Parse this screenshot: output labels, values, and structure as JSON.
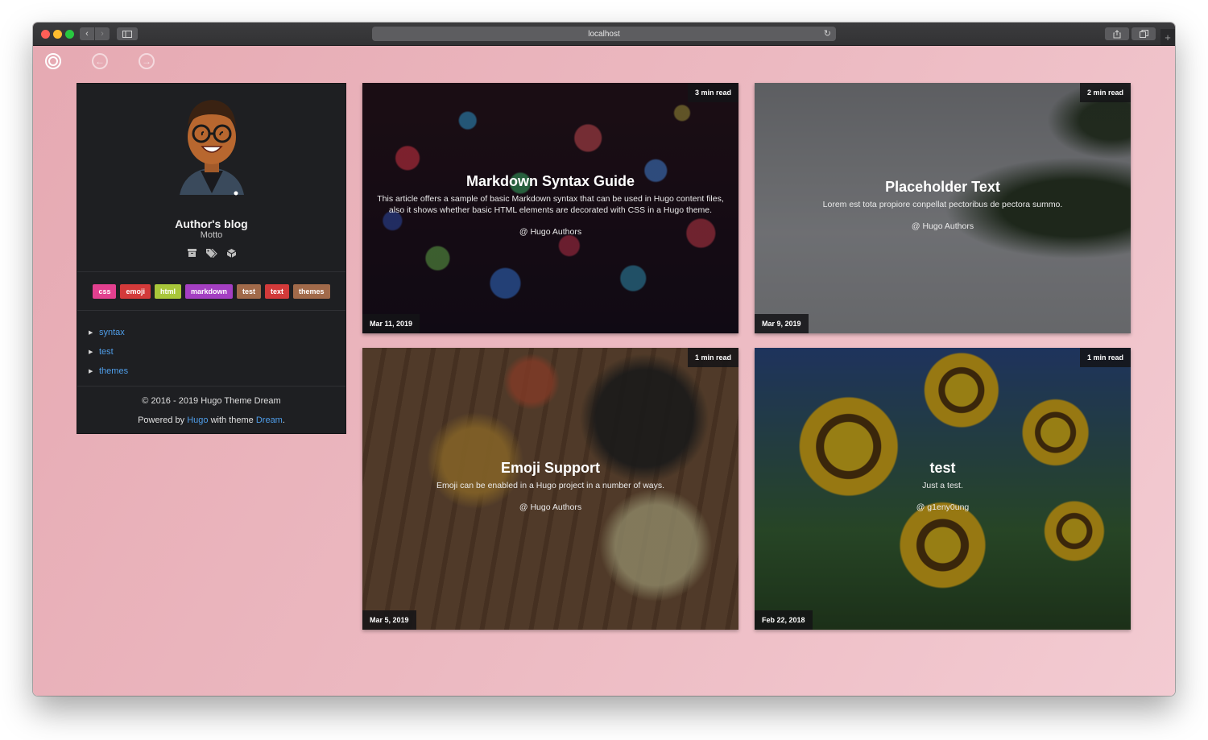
{
  "browser": {
    "url": "localhost"
  },
  "profile": {
    "title": "Author's blog",
    "motto": "Motto",
    "icons": [
      "archive-icon",
      "tags-icon",
      "cube-icon"
    ],
    "tags": [
      {
        "label": "css",
        "color": "#e2408f"
      },
      {
        "label": "emoji",
        "color": "#d33a3a"
      },
      {
        "label": "html",
        "color": "#a8c63a"
      },
      {
        "label": "markdown",
        "color": "#a43fc2"
      },
      {
        "label": "test",
        "color": "#a16a4a"
      },
      {
        "label": "text",
        "color": "#d23a3a"
      },
      {
        "label": "themes",
        "color": "#a16a4a"
      }
    ],
    "categories": [
      "syntax",
      "test",
      "themes"
    ],
    "copyright": "© 2016 - 2019 Hugo Theme Dream",
    "powered_prefix": "Powered by",
    "powered_hugo": "Hugo",
    "powered_mid": "with theme",
    "powered_dream": "Dream",
    "powered_suffix": "."
  },
  "posts": [
    {
      "title": "Markdown Syntax Guide",
      "description": "This article offers a sample of basic Markdown syntax that can be used in Hugo content files, also it shows whether basic HTML elements are decorated with CSS in a Hugo theme.",
      "author": "@ Hugo Authors",
      "read_time": "3 min read",
      "date": "Mar 11, 2019"
    },
    {
      "title": "Placeholder Text",
      "description": "Lorem est tota propiore conpellat pectoribus de pectora summo.",
      "author": "@ Hugo Authors",
      "read_time": "2 min read",
      "date": "Mar 9, 2019"
    },
    {
      "title": "Emoji Support",
      "description": "Emoji can be enabled in a Hugo project in a number of ways.",
      "author": "@ Hugo Authors",
      "read_time": "1 min read",
      "date": "Mar 5, 2019"
    },
    {
      "title": "test",
      "description": "Just a test.",
      "author": "@ g1eny0ung",
      "read_time": "1 min read",
      "date": "Feb 22, 2018"
    }
  ]
}
